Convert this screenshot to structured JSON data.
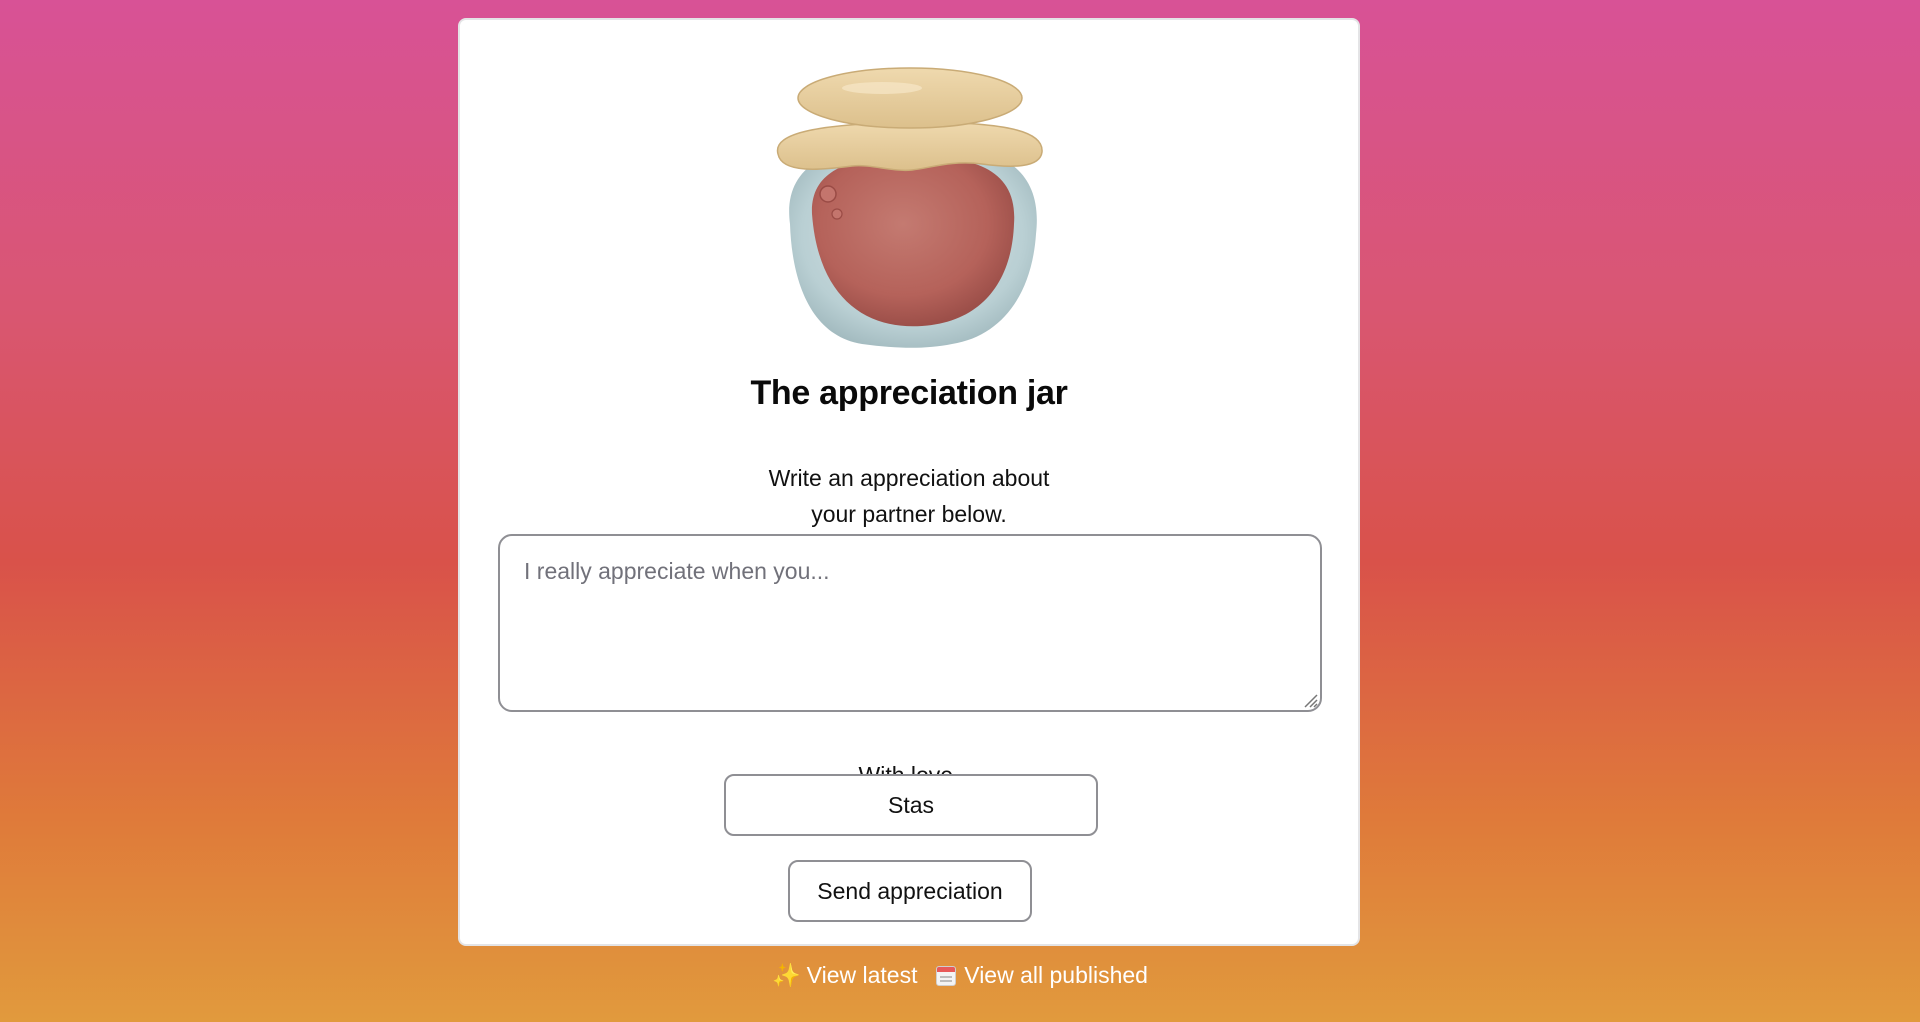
{
  "header": {
    "title": "The appreciation jar",
    "subtitle_line1": "Write an appreciation about",
    "subtitle_line2": "your partner below."
  },
  "form": {
    "message_placeholder": "I really appreciate when you...",
    "message_value": "",
    "signoff_label": "With love,",
    "name_value": "Stas",
    "send_label": "Send appreciation"
  },
  "footer": {
    "view_latest_icon": "✨",
    "view_latest_label": "View latest",
    "view_all_icon": "calendar-icon",
    "view_all_label": "View all published"
  },
  "colors": {
    "gradient_top": "#d85296",
    "gradient_mid": "#d9524a",
    "gradient_bottom": "#e19a3d",
    "card_background": "#ffffff",
    "jam": "#b8675f",
    "lid": "#e6cc9e",
    "glass": "#b8cfd3"
  }
}
